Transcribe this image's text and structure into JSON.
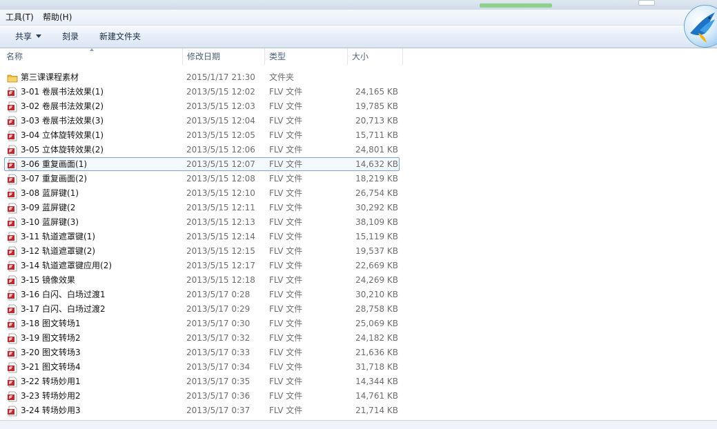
{
  "menu": {
    "tools": "工具(T)",
    "help": "帮助(H)"
  },
  "toolbar": {
    "share": "共享",
    "burn": "刻录",
    "new_folder": "新建文件夹"
  },
  "columns": {
    "name": "名称",
    "modified": "修改日期",
    "type": "类型",
    "size": "大小"
  },
  "colors": {
    "selection_border": "#7da2ce",
    "selection_fill": "#f4f9ff",
    "header_text": "#4c607a",
    "folder": "#e8c14d",
    "flv_red": "#c1272d"
  },
  "files": [
    {
      "name": "第三课课程素材",
      "date": "2015/1/17 21:30",
      "type": "文件夹",
      "size": "",
      "icon": "folder-icon"
    },
    {
      "name": "3-01 卷展书法效果(1)",
      "date": "2013/5/15 12:02",
      "type": "FLV 文件",
      "size": "24,165 KB",
      "icon": "flv-file-icon"
    },
    {
      "name": "3-02 卷展书法效果(2)",
      "date": "2013/5/15 12:03",
      "type": "FLV 文件",
      "size": "19,785 KB",
      "icon": "flv-file-icon"
    },
    {
      "name": "3-03 卷展书法效果(3)",
      "date": "2013/5/15 12:04",
      "type": "FLV 文件",
      "size": "20,713 KB",
      "icon": "flv-file-icon"
    },
    {
      "name": "3-04 立体旋转效果(1)",
      "date": "2013/5/15 12:05",
      "type": "FLV 文件",
      "size": "15,711 KB",
      "icon": "flv-file-icon"
    },
    {
      "name": "3-05 立体旋转效果(2)",
      "date": "2013/5/15 12:06",
      "type": "FLV 文件",
      "size": "24,801 KB",
      "icon": "flv-file-icon"
    },
    {
      "name": "3-06 重复画面(1)",
      "date": "2013/5/15 12:07",
      "type": "FLV 文件",
      "size": "14,632 KB",
      "icon": "flv-file-icon",
      "focused": true
    },
    {
      "name": "3-07 重复画面(2)",
      "date": "2013/5/15 12:08",
      "type": "FLV 文件",
      "size": "18,219 KB",
      "icon": "flv-file-icon"
    },
    {
      "name": "3-08 蓝屏键(1)",
      "date": "2013/5/15 12:10",
      "type": "FLV 文件",
      "size": "26,754 KB",
      "icon": "flv-file-icon"
    },
    {
      "name": "3-09 蓝屏键(2",
      "date": "2013/5/15 12:11",
      "type": "FLV 文件",
      "size": "30,292 KB",
      "icon": "flv-file-icon"
    },
    {
      "name": "3-10 蓝屏键(3)",
      "date": "2013/5/15 12:13",
      "type": "FLV 文件",
      "size": "38,109 KB",
      "icon": "flv-file-icon"
    },
    {
      "name": "3-11 轨道遮罩键(1)",
      "date": "2013/5/15 12:14",
      "type": "FLV 文件",
      "size": "15,119 KB",
      "icon": "flv-file-icon"
    },
    {
      "name": "3-12 轨道遮罩键(2)",
      "date": "2013/5/15 12:15",
      "type": "FLV 文件",
      "size": "19,537 KB",
      "icon": "flv-file-icon"
    },
    {
      "name": "3-14 轨道遮罩键应用(2)",
      "date": "2013/5/15 12:17",
      "type": "FLV 文件",
      "size": "22,669 KB",
      "icon": "flv-file-icon"
    },
    {
      "name": "3-15 镜像效果",
      "date": "2013/5/15 12:18",
      "type": "FLV 文件",
      "size": "24,269 KB",
      "icon": "flv-file-icon"
    },
    {
      "name": "3-16 白闪、白场过渡1",
      "date": "2013/5/17 0:28",
      "type": "FLV 文件",
      "size": "30,210 KB",
      "icon": "flv-file-icon"
    },
    {
      "name": "3-17 白闪、白场过渡2",
      "date": "2013/5/17 0:29",
      "type": "FLV 文件",
      "size": "28,758 KB",
      "icon": "flv-file-icon"
    },
    {
      "name": "3-18 图文转场1",
      "date": "2013/5/17 0:30",
      "type": "FLV 文件",
      "size": "25,069 KB",
      "icon": "flv-file-icon"
    },
    {
      "name": "3-19 图文转场2",
      "date": "2013/5/17 0:32",
      "type": "FLV 文件",
      "size": "24,182 KB",
      "icon": "flv-file-icon"
    },
    {
      "name": "3-20 图文转场3",
      "date": "2013/5/17 0:33",
      "type": "FLV 文件",
      "size": "21,636 KB",
      "icon": "flv-file-icon"
    },
    {
      "name": "3-21 图文转场4",
      "date": "2013/5/17 0:34",
      "type": "FLV 文件",
      "size": "31,718 KB",
      "icon": "flv-file-icon"
    },
    {
      "name": "3-22 转场妙用1",
      "date": "2013/5/17 0:35",
      "type": "FLV 文件",
      "size": "14,344 KB",
      "icon": "flv-file-icon"
    },
    {
      "name": "3-23 转场妙用2",
      "date": "2013/5/17 0:36",
      "type": "FLV 文件",
      "size": "14,761 KB",
      "icon": "flv-file-icon"
    },
    {
      "name": "3-24 转场妙用3",
      "date": "2013/5/17 0:37",
      "type": "FLV 文件",
      "size": "21,714 KB",
      "icon": "flv-file-icon"
    }
  ]
}
